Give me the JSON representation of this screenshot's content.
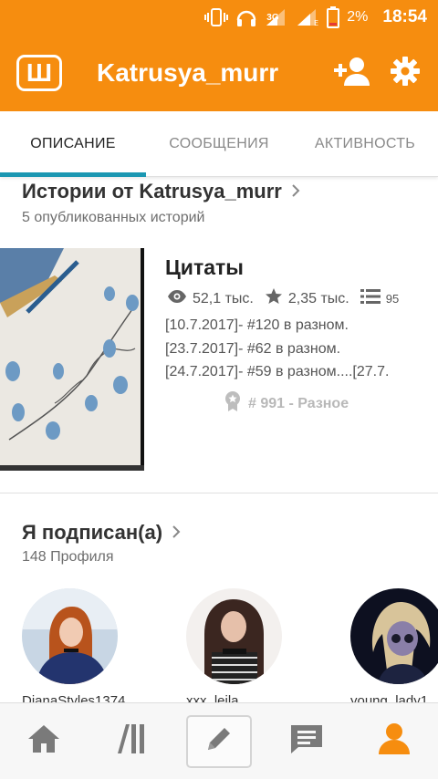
{
  "status_bar": {
    "battery": "2%",
    "time": "18:54",
    "network": "3G",
    "icons": [
      "vibrate-icon",
      "headphones-icon",
      "signal-icon",
      "signal-icon",
      "battery-icon"
    ]
  },
  "app_bar": {
    "logo_letter": "Ш",
    "title": "Katrusya_murr",
    "icons": [
      "add-person-icon",
      "gear-icon"
    ]
  },
  "tabs": [
    {
      "label": "ОПИСАНИЕ",
      "active": true
    },
    {
      "label": "СООБЩЕНИЯ",
      "active": false
    },
    {
      "label": "АКТИВНОСТЬ",
      "active": false
    }
  ],
  "stories": {
    "title": "Истории от Katrusya_murr",
    "subtitle": "5 опубликованных историй",
    "story": {
      "title": "Цитаты",
      "reads": "52,1 тыс.",
      "votes": "2,35 тыс.",
      "parts": "95",
      "lines": [
        "[10.7.2017]- #120 в разном.",
        "[23.7.2017]- #62 в разном.",
        "[24.7.2017]- #59 в разном....[27.7."
      ],
      "rank": "# 991 - Разное"
    }
  },
  "following": {
    "title": "Я подписан(а)",
    "subtitle": "148 Профиля",
    "profiles": [
      {
        "name": "DianaStyles1374"
      },
      {
        "name": "xxx_leila"
      },
      {
        "name": "young_lady1"
      }
    ]
  },
  "bottom_nav": {
    "items": [
      "home-icon",
      "library-icon",
      "write-icon",
      "messages-icon",
      "profile-icon"
    ],
    "active_color": "#f68d0f"
  },
  "colors": {
    "brand": "#f68d0f",
    "tab_indicator": "#1b97b2"
  }
}
